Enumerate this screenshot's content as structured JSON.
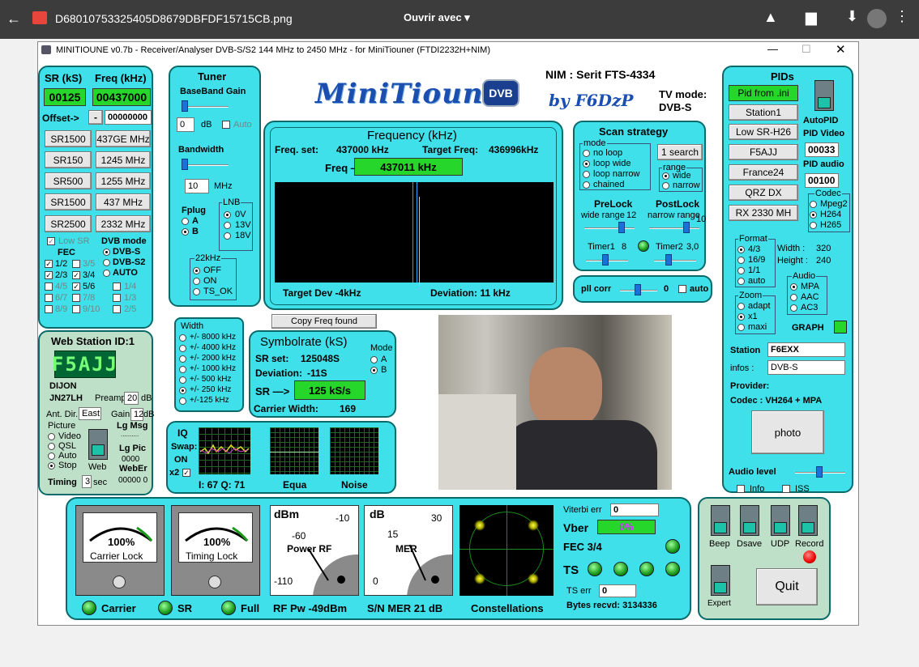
{
  "viewer": {
    "filename": "D68010753325405D8679DBFDF15715CB.png",
    "open_with": "Ouvrir avec"
  },
  "window": {
    "title": "MINITIOUNE v0.7b - Receiver/Analyser DVB-S/S2 144 MHz to 2450 MHz - for MiniTiouner (FTDI2232H+NIM)"
  },
  "left": {
    "sr_header": "SR (kS)",
    "freq_header": "Freq (kHz)",
    "sr_value": "00125",
    "freq_value": "00437000",
    "offset_label": "Offset->",
    "offset_sign": "-",
    "offset_value": "00000000",
    "presets": [
      [
        "SR1500",
        "437GE MHz"
      ],
      [
        "SR150",
        "1245 MHz"
      ],
      [
        "SR500",
        "1255 MHz"
      ],
      [
        "SR1500",
        "437 MHz"
      ],
      [
        "SR2500",
        "2332 MHz"
      ]
    ],
    "low_sr": "Low SR",
    "fec_label": "FEC",
    "fec_items": [
      "1/2",
      "3/5",
      "2/3",
      "3/4",
      "4/5",
      "5/6",
      "6/7",
      "7/8",
      "8/9",
      "9/10",
      "1/4",
      "1/3",
      "2/5"
    ],
    "dvb_mode_label": "DVB mode",
    "dvb_modes": [
      "DVB-S",
      "DVB-S2",
      "AUTO"
    ]
  },
  "web": {
    "title": "Web Station ID:1",
    "callsign": "F5AJJ",
    "city": "DIJON",
    "locator": "JN27LH",
    "preamp_label": "Preamp",
    "preamp_value": "20",
    "preamp_unit": "dB",
    "ant_label": "Ant. Dir.",
    "ant_value": "East",
    "gain_label": "Gain",
    "gain_value": "12",
    "gain_unit": "dB",
    "picture_label": "Picture",
    "picture_opts": [
      "Video",
      "QSL",
      "Auto",
      "Stop"
    ],
    "web_label": "Web",
    "lg_msg": "Lg Msg",
    "lg_msg_dots": "..........",
    "lg_pic": "Lg Pic",
    "lg_pic_value": "0000",
    "weberr": "WebEr",
    "weberr_value": "00000 0",
    "timing_label": "Timing",
    "timing_value": "3",
    "timing_unit": "sec"
  },
  "tuner": {
    "title": "Tuner",
    "bb_gain": "BaseBand Gain",
    "gain_value": "0",
    "gain_unit": "dB",
    "auto": "Auto",
    "bandwidth": "Bandwidth",
    "bw_value": "10",
    "bw_unit": "MHz",
    "fplug": "Fplug",
    "fplug_opts": [
      "A",
      "B"
    ],
    "lnb": "LNB",
    "lnb_opts": [
      "0V",
      "13V",
      "18V"
    ],
    "khz22": "22kHz",
    "khz22_opts": [
      "OFF",
      "ON",
      "TS_OK"
    ]
  },
  "logo": {
    "text": "MiniTioune",
    "dvb": "DVB",
    "by": "by F6DzP",
    "nim": "NIM : Serit FTS-4334",
    "tv_mode_label": "TV mode:",
    "tv_mode": "DVB-S"
  },
  "freq": {
    "title": "Frequency (kHz)",
    "set_label": "Freq. set:",
    "set_value": "437000 kHz",
    "target_label": "Target Freq:",
    "target_value": "436996kHz",
    "arrow_label": "Freq —>",
    "measured": "437011 kHz",
    "target_dev": "Target Dev -4kHz",
    "deviation": "Deviation: 11 kHz",
    "copy_btn": "Copy Freq found"
  },
  "scan": {
    "title": "Scan strategy",
    "mode_label": "mode",
    "modes": [
      "no loop",
      "loop wide",
      "loop narrow",
      "chained"
    ],
    "search_btn": "1 search",
    "range_label": "range",
    "ranges": [
      "wide",
      "narrow"
    ],
    "prelock": "PreLock",
    "prelock_sub": "wide range",
    "prelock_val": "12",
    "postlock": "PostLock",
    "postlock_sub": "narrow range",
    "postlock_val": "10",
    "timer1": "Timer1",
    "timer1_val": "8",
    "timer2": "Timer2",
    "timer2_val": "3,0",
    "pll": "pll corr",
    "pll_val": "0",
    "pll_auto": "auto"
  },
  "width": {
    "title": "Width",
    "opts": [
      "+/- 8000 kHz",
      "+/- 4000 kHz",
      "+/- 2000 kHz",
      "+/- 1000 kHz",
      "+/- 500 kHz",
      "+/- 250 kHz",
      "+/-125 kHz"
    ],
    "selected": 5
  },
  "symbol": {
    "title": "Symbolrate (kS)",
    "set_label": "SR set:",
    "set_value": "125048S",
    "dev_label": "Deviation:",
    "dev_value": "-11S",
    "arrow_label": "SR —>",
    "measured": "125 kS/s",
    "carrier_width": "Carrier Width:",
    "carrier_value": "169",
    "mode_label": "Mode",
    "modes": [
      "A",
      "B"
    ]
  },
  "iq": {
    "title": "IQ",
    "swap": "Swap:",
    "on": "ON",
    "x2": "x2",
    "iq_values": "I: 67 Q: 71",
    "equa": "Equa",
    "noise": "Noise"
  },
  "pids": {
    "title": "PIDs",
    "from_ini": "Pid from .ini",
    "stations": [
      "Station1",
      "Low SR-H26",
      "F5AJJ",
      "France24",
      "QRZ DX",
      "RX 2330 MH"
    ],
    "autopid": "AutoPID",
    "pid_video_label": "PID Video",
    "pid_video": "00033",
    "pid_audio_label": "PID audio",
    "pid_audio": "00100",
    "codec_label": "Codec",
    "codecs": [
      "Mpeg2",
      "H264",
      "H265"
    ],
    "format_label": "Format",
    "formats": [
      "4/3",
      "16/9",
      "1/1",
      "auto"
    ],
    "width_label": "Width :",
    "width_value": "320",
    "height_label": "Height :",
    "height_value": "240",
    "audio_label": "Audio",
    "audios": [
      "MPA",
      "AAC",
      "AC3"
    ],
    "zoom_label": "Zoom",
    "zooms": [
      "adapt",
      "x1",
      "maxi"
    ],
    "graph": "GRAPH",
    "station_label": "Station",
    "station_value": "F6EXX",
    "infos_label": "infos :",
    "infos_value": "DVB-S",
    "provider": "Provider:",
    "codec_info": "Codec :  VH264 + MPA",
    "photo": "photo",
    "audio_level": "Audio level",
    "info": "Info",
    "iss": "ISS"
  },
  "bottom": {
    "carrier_pct": "100%",
    "carrier_lock": "Carrier Lock",
    "timing_pct": "100%",
    "timing_lock": "Timing Lock",
    "dbm": "dBm",
    "power_rf": "Power RF",
    "pw_ticks": [
      "-10",
      "-60",
      "-110"
    ],
    "db": "dB",
    "mer": "MER",
    "mer_ticks": [
      "30",
      "15",
      "0"
    ],
    "carrier_led": "Carrier",
    "sr_led": "SR",
    "full_led": "Full",
    "rf_pw": "RF Pw -49dBm",
    "sn_mer": "S/N MER  21 dB",
    "constellations": "Constellations",
    "viterbi_label": "Viterbi err",
    "viterbi_value": "0",
    "vber_label": "Vber",
    "vber_value": "0%",
    "fec": "FEC 3/4",
    "ts": "TS",
    "ts_err_label": "TS err",
    "ts_err_value": "0",
    "bytes": "Bytes recvd:  3134336"
  },
  "controls": {
    "beep": "Beep",
    "dsave": "Dsave",
    "udp": "UDP",
    "record": "Record",
    "expert": "Expert",
    "quit": "Quit"
  }
}
